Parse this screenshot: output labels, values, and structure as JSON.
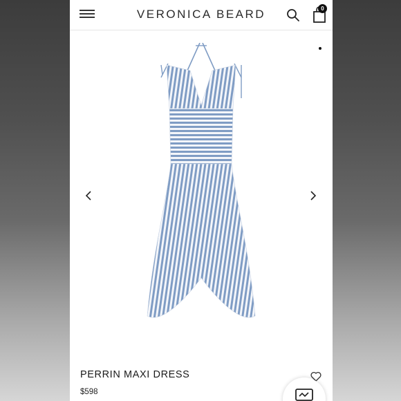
{
  "header": {
    "brand": "VERONICA BEARD",
    "bag_count": "0",
    "icons": {
      "menu": "hamburger-menu-icon",
      "search": "search-icon",
      "bag": "shopping-bag-icon"
    }
  },
  "gallery": {
    "image_alt": "blue and white striped maxi dress",
    "icons": {
      "prev": "chevron-left-icon",
      "next": "chevron-right-icon"
    }
  },
  "product": {
    "name": "PERRIN MAXI DRESS",
    "price": "$598",
    "icons": {
      "wishlist": "heart-icon",
      "chat": "chat-icon"
    }
  },
  "colors": {
    "stripe_blue": "#7f9cc4",
    "text": "#1a1a1a",
    "background": "#ffffff"
  }
}
